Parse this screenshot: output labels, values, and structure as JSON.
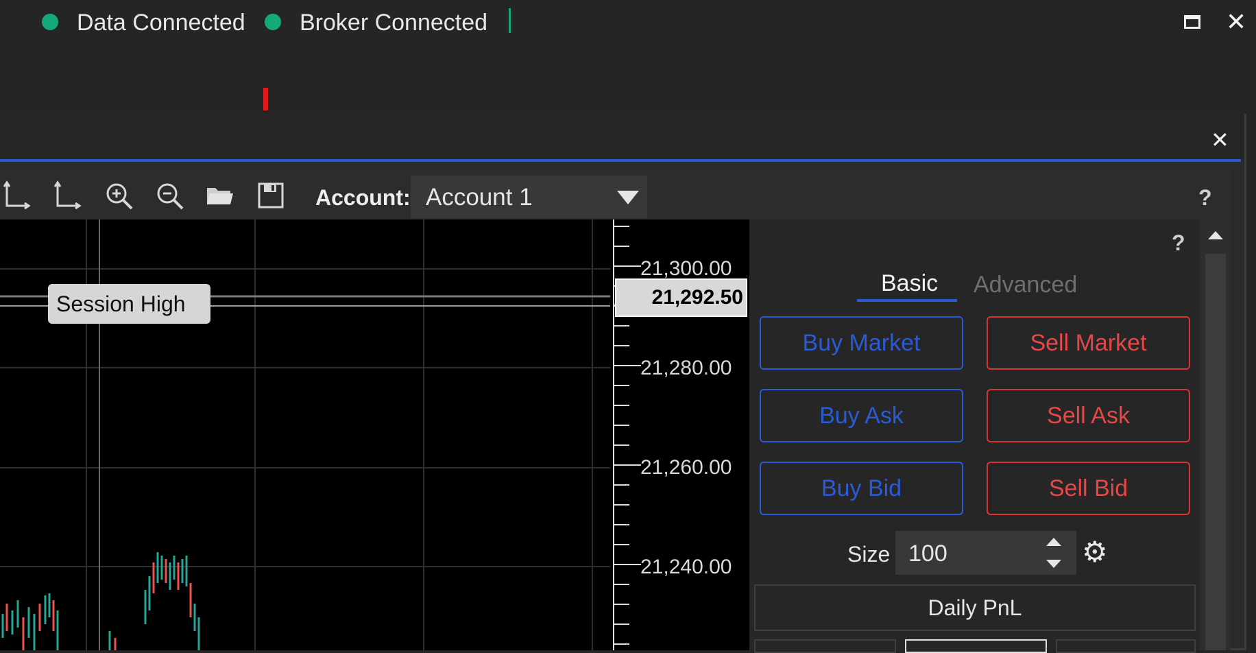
{
  "status": {
    "data": "Data Connected",
    "broker": "Broker Connected",
    "connected_color": "#13a97a"
  },
  "window_controls": {
    "maximize_icon": "maximize-icon",
    "close_icon": "close-icon"
  },
  "panel": {
    "close_icon": "close-icon"
  },
  "toolbar": {
    "icons": [
      "axis-drag-icon",
      "axis-drag-icon",
      "zoom-in-icon",
      "zoom-out-icon",
      "folder-open-icon",
      "save-icon"
    ],
    "account_label": "Account:",
    "account_value": "Account 1",
    "help": "?"
  },
  "chart": {
    "y_ticks": [
      "21,300.00",
      "21,280.00",
      "21,260.00",
      "21,240.00"
    ],
    "session_high_label": "Session High",
    "last_price": "21,292.50",
    "up_color": "#26a69a",
    "down_color": "#ef5350"
  },
  "order_panel": {
    "help": "?",
    "tabs": {
      "basic": "Basic",
      "advanced": "Advanced",
      "active": "Basic"
    },
    "buttons": {
      "buy_market": "Buy Market",
      "sell_market": "Sell Market",
      "buy_ask": "Buy Ask",
      "sell_ask": "Sell Ask",
      "buy_bid": "Buy Bid",
      "sell_bid": "Sell Bid"
    },
    "size_label": "Size",
    "size_value": "100",
    "daily_pnl": "Daily PnL"
  }
}
